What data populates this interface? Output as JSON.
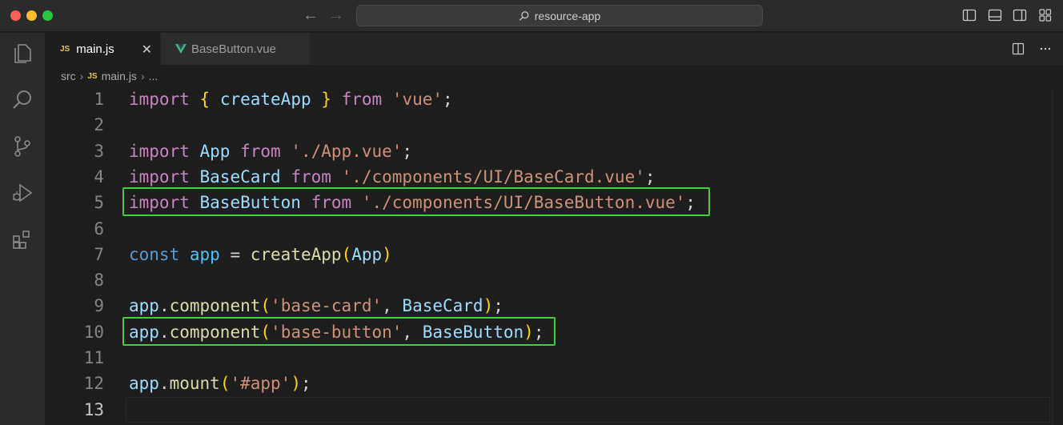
{
  "window": {
    "title": "resource-app"
  },
  "tabs": [
    {
      "label": "main.js",
      "badge": "JS",
      "active": true
    },
    {
      "label": "BaseButton.vue",
      "badge": "vue",
      "active": false
    }
  ],
  "breadcrumb": {
    "folder": "src",
    "badge": "JS",
    "file": "main.js",
    "ellipsis": "..."
  },
  "editor": {
    "active_line": "13",
    "highlight_color": "#3fcf3f",
    "lines": [
      {
        "n": "1",
        "tokens": [
          [
            "kw",
            "import"
          ],
          [
            "pl",
            " "
          ],
          [
            "br",
            "{"
          ],
          [
            "pl",
            " "
          ],
          [
            "id",
            "createApp"
          ],
          [
            "pl",
            " "
          ],
          [
            "br",
            "}"
          ],
          [
            "pl",
            " "
          ],
          [
            "kw",
            "from"
          ],
          [
            "pl",
            " "
          ],
          [
            "str",
            "'vue'"
          ],
          [
            "pl",
            ";"
          ]
        ]
      },
      {
        "n": "2",
        "tokens": []
      },
      {
        "n": "3",
        "tokens": [
          [
            "kw",
            "import"
          ],
          [
            "pl",
            " "
          ],
          [
            "id",
            "App"
          ],
          [
            "pl",
            " "
          ],
          [
            "kw",
            "from"
          ],
          [
            "pl",
            " "
          ],
          [
            "str",
            "'./App.vue'"
          ],
          [
            "pl",
            ";"
          ]
        ]
      },
      {
        "n": "4",
        "tokens": [
          [
            "kw",
            "import"
          ],
          [
            "pl",
            " "
          ],
          [
            "id",
            "BaseCard"
          ],
          [
            "pl",
            " "
          ],
          [
            "kw",
            "from"
          ],
          [
            "pl",
            " "
          ],
          [
            "str",
            "'./components/UI/BaseCard.vue'"
          ],
          [
            "pl",
            ";"
          ]
        ]
      },
      {
        "n": "5",
        "tokens": [
          [
            "kw",
            "import"
          ],
          [
            "pl",
            " "
          ],
          [
            "id",
            "BaseButton"
          ],
          [
            "pl",
            " "
          ],
          [
            "kw",
            "from"
          ],
          [
            "pl",
            " "
          ],
          [
            "str",
            "'./components/UI/BaseButton.vue'"
          ],
          [
            "pl",
            ";"
          ]
        ],
        "highlighted": true
      },
      {
        "n": "6",
        "tokens": []
      },
      {
        "n": "7",
        "tokens": [
          [
            "kw2",
            "const"
          ],
          [
            "pl",
            " "
          ],
          [
            "cls",
            "app"
          ],
          [
            "pl",
            " = "
          ],
          [
            "fn",
            "createApp"
          ],
          [
            "br",
            "("
          ],
          [
            "id",
            "App"
          ],
          [
            "br",
            ")"
          ]
        ]
      },
      {
        "n": "8",
        "tokens": []
      },
      {
        "n": "9",
        "tokens": [
          [
            "id",
            "app"
          ],
          [
            "pl",
            "."
          ],
          [
            "fn",
            "component"
          ],
          [
            "br",
            "("
          ],
          [
            "str",
            "'base-card'"
          ],
          [
            "pl",
            ", "
          ],
          [
            "id",
            "BaseCard"
          ],
          [
            "br",
            ")"
          ],
          [
            "pl",
            ";"
          ]
        ]
      },
      {
        "n": "10",
        "tokens": [
          [
            "id",
            "app"
          ],
          [
            "pl",
            "."
          ],
          [
            "fn",
            "component"
          ],
          [
            "br",
            "("
          ],
          [
            "str",
            "'base-button'"
          ],
          [
            "pl",
            ", "
          ],
          [
            "id",
            "BaseButton"
          ],
          [
            "br",
            ")"
          ],
          [
            "pl",
            ";"
          ]
        ],
        "highlighted": true
      },
      {
        "n": "11",
        "tokens": []
      },
      {
        "n": "12",
        "tokens": [
          [
            "id",
            "app"
          ],
          [
            "pl",
            "."
          ],
          [
            "fn",
            "mount"
          ],
          [
            "br",
            "("
          ],
          [
            "str",
            "'#app'"
          ],
          [
            "br",
            ")"
          ],
          [
            "pl",
            ";"
          ]
        ]
      },
      {
        "n": "13",
        "tokens": []
      }
    ]
  },
  "activity_icons": [
    "explorer-icon",
    "search-icon",
    "source-control-icon",
    "run-debug-icon",
    "extensions-icon"
  ]
}
